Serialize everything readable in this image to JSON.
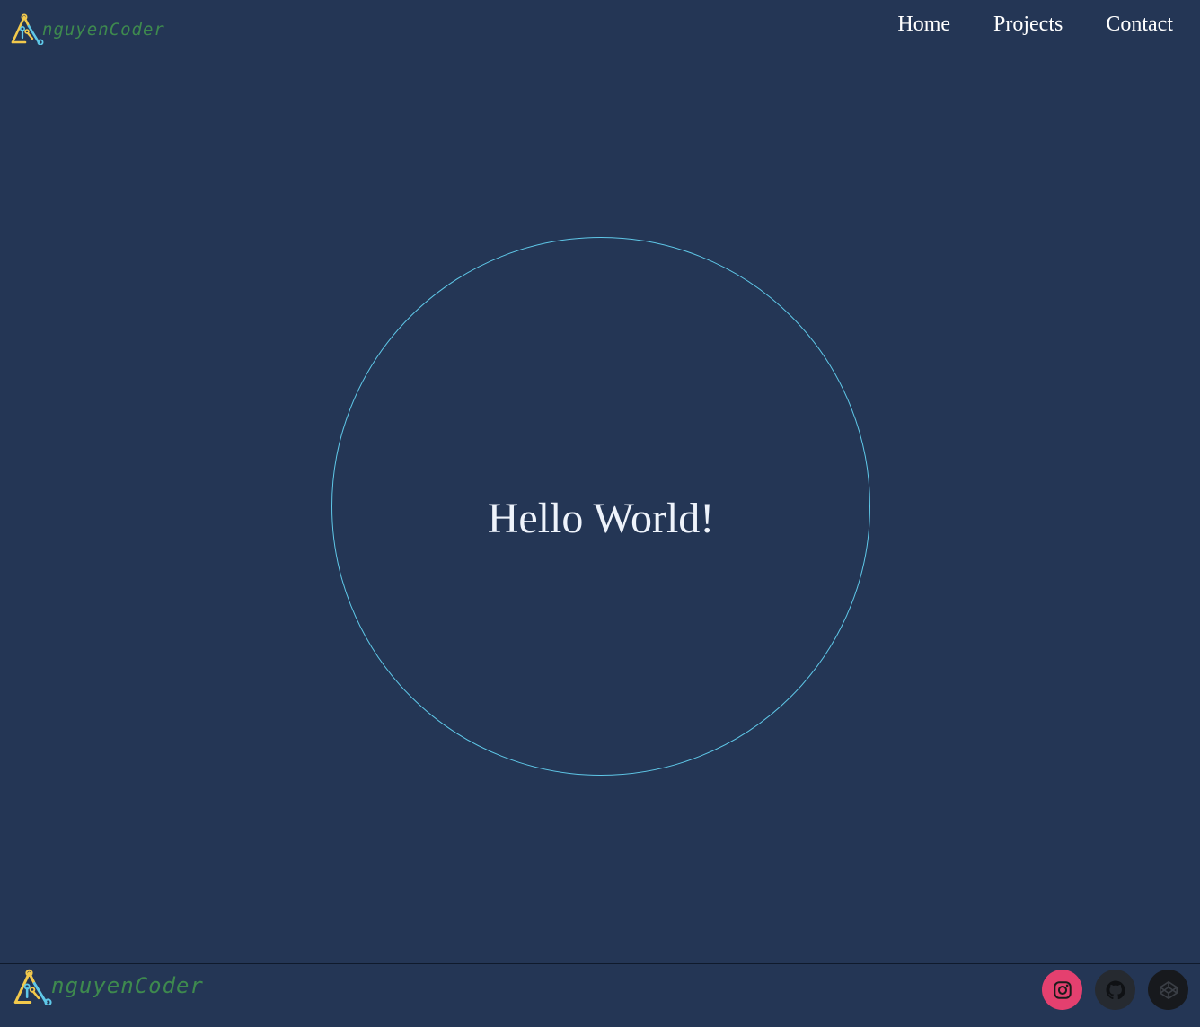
{
  "brand": {
    "name": "nguyenCoder",
    "logo_icon": "a-circuit-logo-icon"
  },
  "nav": {
    "items": [
      {
        "label": "Home"
      },
      {
        "label": "Projects"
      },
      {
        "label": "Contact"
      }
    ]
  },
  "hero": {
    "heading": "Hello World!"
  },
  "footer": {
    "brand_name": "nguyenCoder",
    "social": [
      {
        "name": "instagram",
        "icon": "instagram-icon",
        "color": "#e4406f"
      },
      {
        "name": "github",
        "icon": "github-icon",
        "color": "#262a30"
      },
      {
        "name": "codepen",
        "icon": "codepen-icon",
        "color": "#17191d"
      }
    ]
  },
  "colors": {
    "background": "#243655",
    "accent_circle": "#5fc8e8",
    "brand_text": "#3e8a4e",
    "logo_yellow": "#f2c94c",
    "logo_blue": "#5fc8e8"
  }
}
